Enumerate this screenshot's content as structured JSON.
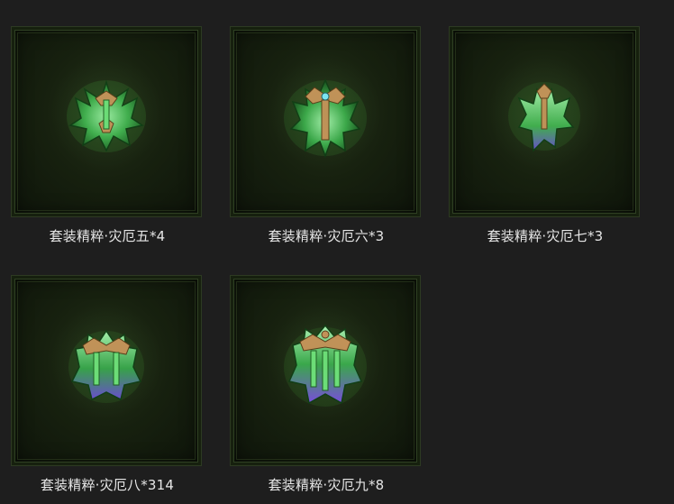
{
  "items": [
    {
      "label": "套装精粹·灾厄五*4",
      "icon": "set-essence-calamity-5-icon"
    },
    {
      "label": "套装精粹·灾厄六*3",
      "icon": "set-essence-calamity-6-icon"
    },
    {
      "label": "套装精粹·灾厄七*3",
      "icon": "set-essence-calamity-7-icon"
    },
    {
      "label": "套装精粹·灾厄八*314",
      "icon": "set-essence-calamity-8-icon"
    },
    {
      "label": "套装精粹·灾厄九*8",
      "icon": "set-essence-calamity-9-icon"
    }
  ],
  "colors": {
    "background": "#1e1e1e",
    "frame_border": "#2d3a22",
    "label_text": "#e6e6e6",
    "gem_green": "#4fd06a",
    "gem_gold": "#c8915a",
    "gem_purple": "#8a5ad8"
  }
}
